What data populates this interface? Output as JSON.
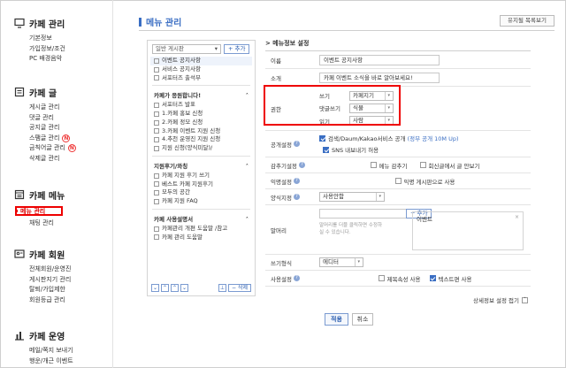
{
  "sidebar": {
    "sections": [
      {
        "title": "카페 관리",
        "items": [
          "기본정보",
          "가입정보/조건",
          "PC 배경음악"
        ]
      },
      {
        "title": "카페 글",
        "items": [
          "게시글 관리",
          "댓글 관리",
          "공지글 관리",
          "스팸글 관리",
          "금칙어글 관리",
          "삭제글 관리"
        ]
      },
      {
        "title": "카페 메뉴",
        "items": [
          "메뉴 관리",
          "채팅 관리"
        ]
      },
      {
        "title": "카페 회원",
        "items": [
          "전체회원/운영진",
          "게시판지기 관리",
          "탈퇴/가입제한",
          "회원등급 관리"
        ]
      },
      {
        "title": "카페 운영",
        "items": [
          "메일/쪽지 보내기",
          "행운/개근 이벤트"
        ]
      }
    ],
    "new_badge": "N"
  },
  "header": {
    "title": "메뉴 관리",
    "help_button": "유지될 목록보기"
  },
  "menu_panel": {
    "type_select": "일반 게시판",
    "add_button": "+ 추가",
    "items_top": [
      "이벤트 공지사항",
      "서비스 공지사항",
      "서포터즈 출석부"
    ],
    "group1": {
      "title": "카페가 응원합니다!",
      "items": [
        "서포터즈 발표",
        "1.카페 홍보 신청",
        "2.카페 정모 신청",
        "3.카페 이벤트 지원 신청",
        "4.추천 운영진 지원 신청",
        "지원 신청(양식미달)/"
      ]
    },
    "group2": {
      "title": "지원후기/와칭",
      "items": [
        "카페 지원 후기 쓰기",
        "베스트 카페 지원후기",
        "모두의 공간",
        "카페 지원 FAQ"
      ]
    },
    "group3": {
      "title": "카페 사용설명서",
      "items": [
        "카페관리 개편 도움말 /참고",
        "카페 관리 도움말"
      ]
    },
    "foot_delete": "− 삭제",
    "arrows": [
      "⌄",
      "⌃",
      "⌃",
      "⌄"
    ]
  },
  "settings": {
    "section_title": "> 메뉴정보 설정",
    "name_label": "이름",
    "name_value": "이벤트 공지사항",
    "desc_label": "소개",
    "desc_value": "카페 이벤트 소식을 바로 알아보세요!",
    "perm_label": "권한",
    "perms": [
      {
        "label": "쓰기",
        "value": "카페지기"
      },
      {
        "label": "댓글쓰기",
        "value": "식물"
      },
      {
        "label": "읽기",
        "value": "사람"
      }
    ],
    "public_label": "공개설정",
    "public_opt1": "검색/Daum/Kakao서비스 공개",
    "public_opt1_note": "(정부 공개 10M Up)",
    "public_opt2": "SNS 내보내기 허용",
    "lock_label": "감추기설정",
    "lock_opt1": "메뉴 감추기",
    "lock_opt2": "회신글에서 글 안보기",
    "anon_label": "익명설정",
    "anon_opt": "익명 게시판으로 사용",
    "form_label": "양식지정",
    "form_value": "사용안함",
    "header_label": "말머리",
    "header_add": "+ 추가",
    "header_note": "말머리를 더블 클릭하면 수정하실 수 있습니다.",
    "header_tag": "이벤트",
    "write_label": "쓰기형식",
    "write_value": "에디터",
    "use_label": "사용설정",
    "use_opt1": "제목속성 사용",
    "use_opt2": "텍스트편 사용",
    "more_link": "상세정보 설정 접기",
    "apply": "적용",
    "cancel": "취소"
  }
}
